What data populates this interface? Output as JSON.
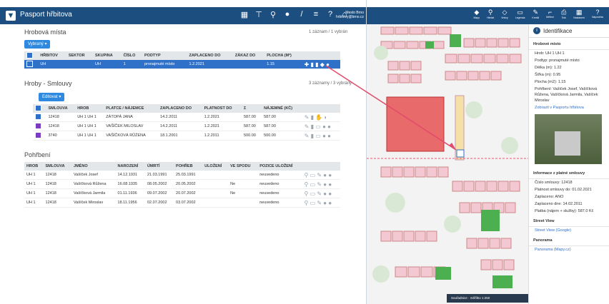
{
  "left": {
    "title": "Pasport hřbitova",
    "user": [
      "Mesto Brno",
      "hrbitovy@brno.cz"
    ],
    "grave_section": {
      "title": "Hrobová místa",
      "count": "1 záznam / 1 vybrán",
      "button": "Vybraný",
      "headers": [
        "HŘBITOV",
        "SEKTOR",
        "SKUPINA",
        "ČÍSLO",
        "PODTYP",
        "ZAPLACENO DO",
        "ZÁKAZ DO",
        "PLOCHA (M²)"
      ],
      "rows": [
        [
          "UH",
          "",
          "UH",
          "1",
          "pronajmuté místo",
          "1.2.2021",
          "",
          "1.15"
        ]
      ]
    },
    "contracts": {
      "title": "Hroby - Smlouvy",
      "count": "3 záznamy / 3 vybrány",
      "button": "Editovat",
      "headers": [
        "SMLOUVA",
        "HROB",
        "PLATCE / NÁJEMCE",
        "ZAPLACENO DO",
        "PLATNOST DO",
        "Σ",
        "NÁJEMNÉ (KČ)"
      ],
      "rows": [
        [
          "12418",
          "UH 1 UH 1",
          "ZÁTOPÁ JANA",
          "14.2.2011",
          "1.2.2021",
          "587.00",
          "587.00"
        ],
        [
          "12418",
          "UH 1 UH 1",
          "VAŠÍČEK MILOSLAV",
          "14.2.2011",
          "1.2.2021",
          "587.00",
          "587.00"
        ],
        [
          "3740",
          "UH 1 UH 1",
          "VAŠÍČKOVÁ RŮŽENA",
          "18.1.2001",
          "1.2.2011",
          "500.00",
          "500.00"
        ]
      ]
    },
    "burials": {
      "title": "Pohřbení",
      "headers": [
        "HROB",
        "SMLOUVA",
        "JMÉNO",
        "NAROZENÍ",
        "ÚMRTÍ",
        "POHŘEB",
        "ULOŽENÍ",
        "VE SPODU",
        "POZICE ULOŽENÍ"
      ],
      "rows": [
        [
          "UH 1",
          "12418",
          "Vašíček Josef",
          "14.12.1931",
          "21.03.1991",
          "25.03.1991",
          "",
          "",
          "neuvedeno"
        ],
        [
          "UH 1",
          "12418",
          "Vašíčková Růžena",
          "16.08.1935",
          "08.05.2002",
          "20.05.2002",
          "",
          "Ne",
          "neuvedeno"
        ],
        [
          "UH 1",
          "12418",
          "Vašíčková Jarmila",
          "01.11.1936",
          "09.07.2002",
          "20.07.2002",
          "",
          "Ne",
          "neuvedeno"
        ],
        [
          "UH 1",
          "12418",
          "Vašíček Miroslav",
          "18.11.1956",
          "02.07.2002",
          "03.07.2002",
          "",
          "",
          "neuvedeno"
        ]
      ]
    }
  },
  "right": {
    "toolbar": [
      "Mapy",
      "Hledat",
      "Vrstvy",
      "Legenda",
      "Kreslit",
      "Měření",
      "Tisk",
      "Nastavení",
      "Nápověda"
    ],
    "panel_title": "Identifikace",
    "grave_title": "Hrobové místo",
    "grave_lines": [
      "Hrob: UH 1 UH 1",
      "Podtyp: pronajmuté místo",
      "Délka (m): 1.22",
      "Šířka (m): 0.95",
      "Plocha (m2): 1.15",
      "Pohřbení: Vašíček Josef, Vašíčková Růžena, Vašíčková Jarmila, Vašíček Miroslav"
    ],
    "passport_link": "Zobrazit v Pasportu hřbitova",
    "contract_title": "Informace z platné smlouvy",
    "contract_lines": [
      "Číslo smlouvy: 12418",
      "Platnost smlouvy do: 01.02.2021",
      "Zaplaceno: ANO",
      "Zaplaceno dne: 14.02.2011",
      "Platba (nájem + služby): 587.0 Kč"
    ],
    "street_title": "Street View",
    "street_link": "Street View (Google)",
    "pano_title": "Panorama",
    "pano_link": "Panorama (Mapy.cz)",
    "map_bar": "Souřadnice  ·  měřítko 1:250",
    "colors": {
      "header": "#1d4e80",
      "accent": "#2f70c8",
      "grave": "#f4c8d2",
      "green": "#4caf50",
      "selected": "#e86a6a"
    }
  }
}
